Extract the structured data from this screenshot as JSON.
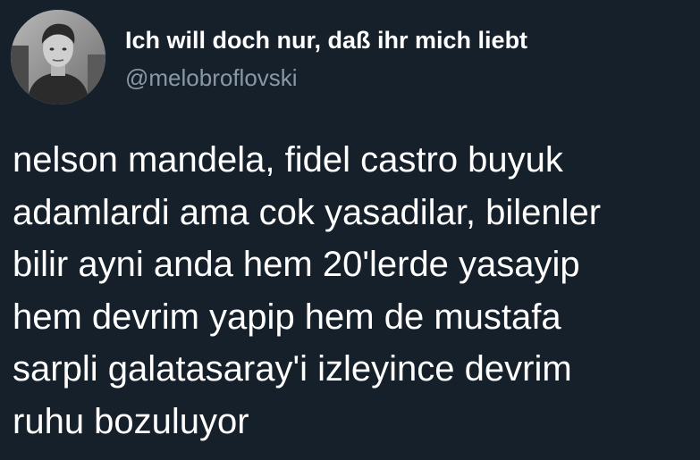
{
  "user": {
    "display_name": "Ich will doch nur, daß ihr mich liebt",
    "handle": "@melobroflovski",
    "avatar_icon": "profile-photo"
  },
  "tweet": {
    "lines": [
      "nelson mandela, fidel castro buyuk",
      "adamlardi ama cok yasadilar, bilenler",
      "bilir ayni anda hem 20'lerde yasayip",
      "hem devrim yapip hem de mustafa",
      "sarpli galatasaray'i izleyince devrim",
      "ruhu bozuluyor"
    ]
  },
  "colors": {
    "background": "#15202b",
    "primary_text": "#ffffff",
    "secondary_text": "#8899a6"
  }
}
